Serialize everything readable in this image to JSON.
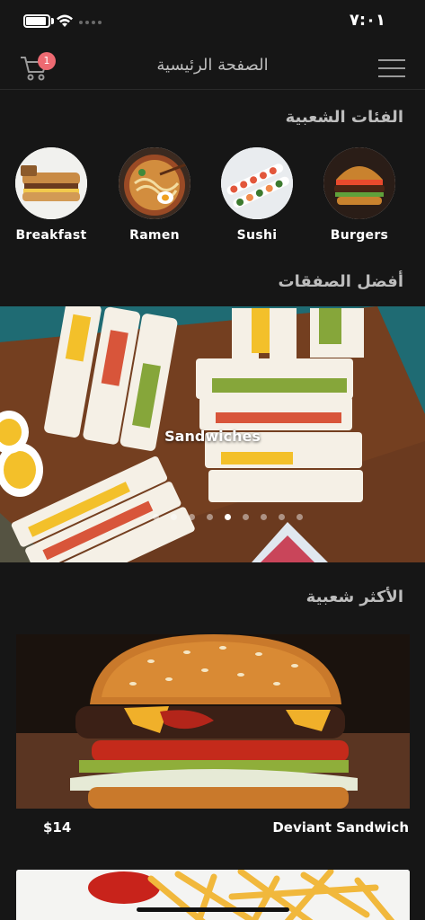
{
  "status_bar": {
    "time": "٧:٠١"
  },
  "nav": {
    "title": "الصفحة الرئيسية",
    "cart_count": "1"
  },
  "sections": {
    "categories_title": "الفئات الشعبية",
    "deals_title": "أفضل الصفقات",
    "popular_title": "الأكثر شعبية"
  },
  "categories": [
    {
      "label": "Breakfast",
      "icon": "breakfast-icon"
    },
    {
      "label": "Ramen",
      "icon": "ramen-icon"
    },
    {
      "label": "Sushi",
      "icon": "sushi-icon"
    },
    {
      "label": "Burgers",
      "icon": "burger-icon"
    }
  ],
  "banner": {
    "label": "Sandwiches",
    "pages": 9,
    "active_page": 5
  },
  "popular": [
    {
      "name": "Deviant Sandwich",
      "price": "$14"
    }
  ],
  "colors": {
    "background": "#161616",
    "badge": "#ee6a72",
    "title_gray": "#bdbdbd"
  }
}
